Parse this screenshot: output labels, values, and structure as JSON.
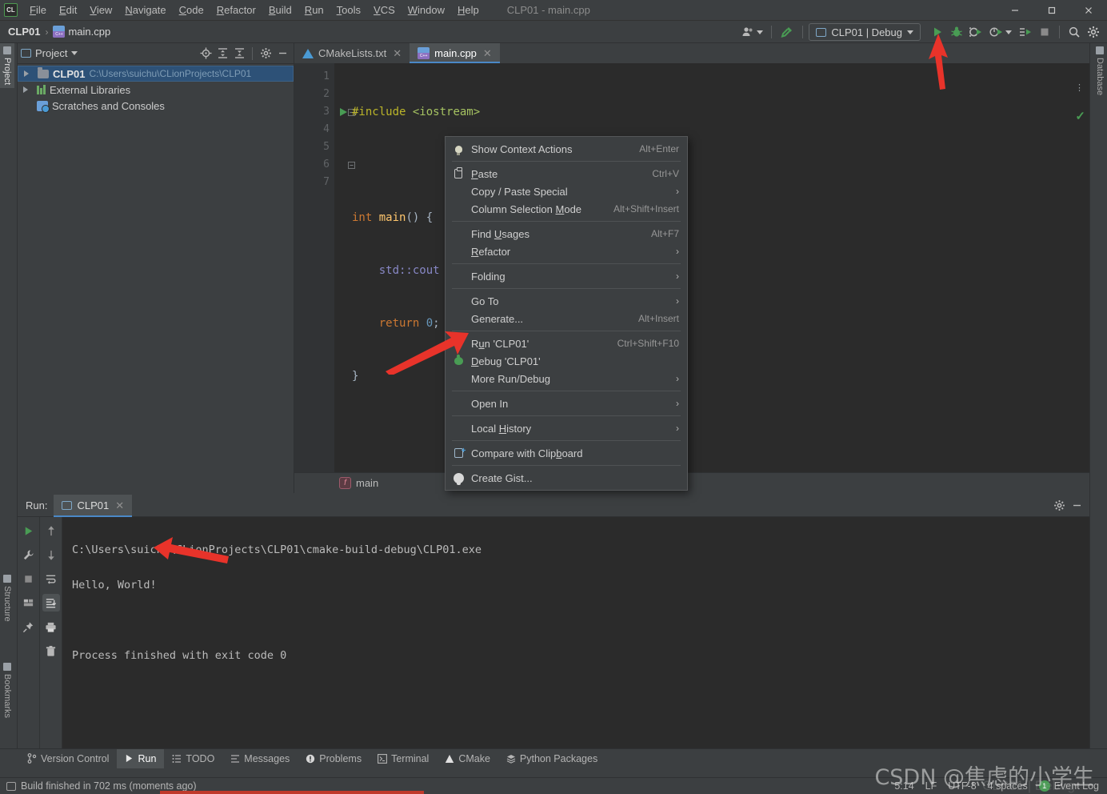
{
  "window": {
    "title": "CLP01 - main.cpp",
    "app_icon": "CL",
    "controls": {
      "minimize": "minimize-icon",
      "maximize": "maximize-icon",
      "close": "close-icon"
    }
  },
  "menubar": {
    "items": [
      {
        "label": "File",
        "mnemonic": "F"
      },
      {
        "label": "Edit",
        "mnemonic": "E"
      },
      {
        "label": "View",
        "mnemonic": "V"
      },
      {
        "label": "Navigate",
        "mnemonic": "N"
      },
      {
        "label": "Code",
        "mnemonic": "C"
      },
      {
        "label": "Refactor",
        "mnemonic": "R"
      },
      {
        "label": "Build",
        "mnemonic": "B"
      },
      {
        "label": "Run",
        "mnemonic": "R"
      },
      {
        "label": "Tools",
        "mnemonic": "T"
      },
      {
        "label": "VCS",
        "mnemonic": "V"
      },
      {
        "label": "Window",
        "mnemonic": "W"
      },
      {
        "label": "Help",
        "mnemonic": "H"
      }
    ]
  },
  "navbar": {
    "project": "CLP01",
    "separator": "›",
    "file": "main.cpp"
  },
  "toolbar": {
    "run_config": "CLP01 | Debug",
    "buttons": [
      "user-account-icon",
      "build-hammer-icon",
      "run-icon",
      "debug-icon",
      "run-with-coverage-icon",
      "profile-icon",
      "attach-process-icon",
      "stop-icon",
      "search-everywhere-icon",
      "settings-gear-icon"
    ]
  },
  "rails": {
    "left": [
      {
        "label": "Project",
        "selected": true
      },
      {
        "label": "Structure",
        "selected": false
      },
      {
        "label": "Bookmarks",
        "selected": false
      }
    ],
    "right": [
      {
        "label": "Database",
        "selected": false
      }
    ]
  },
  "project_panel": {
    "title": "Project",
    "toolbar": [
      "locate-target-icon",
      "expand-all-icon",
      "collapse-all-icon",
      "settings-gear-icon",
      "hide-icon"
    ],
    "tree": [
      {
        "name": "CLP01",
        "path": "C:\\Users\\suichu\\CLionProjects\\CLP01",
        "icon": "folder-icon",
        "selected": true,
        "expandable": true
      },
      {
        "name": "External Libraries",
        "path": "",
        "icon": "library-icon",
        "selected": false,
        "expandable": true
      },
      {
        "name": "Scratches and Consoles",
        "path": "",
        "icon": "scratches-icon",
        "selected": false,
        "expandable": false
      }
    ]
  },
  "editor": {
    "tabs": [
      {
        "label": "CMakeLists.txt",
        "icon": "cmake-icon",
        "active": false
      },
      {
        "label": "main.cpp",
        "icon": "cpp-file-icon",
        "active": true
      }
    ],
    "line_numbers": [
      "1",
      "2",
      "3",
      "4",
      "5",
      "6",
      "7"
    ],
    "code_lines": [
      "#include <iostream>",
      "",
      "int main() {",
      "    std::cout << \"Hello, World!\" << std::endl;",
      "    return 0;",
      "}",
      ""
    ],
    "breadcrumb": "main",
    "inspection_status": "no-errors-check-icon"
  },
  "context_menu": {
    "items": [
      {
        "label": "Show Context Actions",
        "mnemonic": "",
        "shortcut": "Alt+Enter",
        "icon": "lightbulb-icon",
        "submenu": false
      },
      {
        "separator": true
      },
      {
        "label": "Paste",
        "mnemonic": "P",
        "shortcut": "Ctrl+V",
        "icon": "clipboard-icon",
        "submenu": false
      },
      {
        "label": "Copy / Paste Special",
        "mnemonic": "",
        "shortcut": "",
        "icon": "",
        "submenu": true
      },
      {
        "label": "Column Selection Mode",
        "mnemonic": "M",
        "shortcut": "Alt+Shift+Insert",
        "icon": "",
        "submenu": false
      },
      {
        "separator": true
      },
      {
        "label": "Find Usages",
        "mnemonic": "U",
        "shortcut": "Alt+F7",
        "icon": "",
        "submenu": false
      },
      {
        "label": "Refactor",
        "mnemonic": "R",
        "shortcut": "",
        "icon": "",
        "submenu": true
      },
      {
        "separator": true
      },
      {
        "label": "Folding",
        "mnemonic": "",
        "shortcut": "",
        "icon": "",
        "submenu": true
      },
      {
        "separator": true
      },
      {
        "label": "Go To",
        "mnemonic": "",
        "shortcut": "",
        "icon": "",
        "submenu": true
      },
      {
        "label": "Generate...",
        "mnemonic": "",
        "shortcut": "Alt+Insert",
        "icon": "",
        "submenu": false
      },
      {
        "separator": true
      },
      {
        "label": "Run 'CLP01'",
        "mnemonic": "u",
        "shortcut": "Ctrl+Shift+F10",
        "icon": "run-icon",
        "submenu": false
      },
      {
        "label": "Debug 'CLP01'",
        "mnemonic": "D",
        "shortcut": "",
        "icon": "debug-icon",
        "submenu": false
      },
      {
        "label": "More Run/Debug",
        "mnemonic": "",
        "shortcut": "",
        "icon": "",
        "submenu": true
      },
      {
        "separator": true
      },
      {
        "label": "Open In",
        "mnemonic": "",
        "shortcut": "",
        "icon": "",
        "submenu": true
      },
      {
        "separator": true
      },
      {
        "label": "Local History",
        "mnemonic": "H",
        "shortcut": "",
        "icon": "",
        "submenu": true
      },
      {
        "separator": true
      },
      {
        "label": "Compare with Clipboard",
        "mnemonic": "b",
        "shortcut": "",
        "icon": "compare-icon",
        "submenu": false
      },
      {
        "separator": true
      },
      {
        "label": "Create Gist...",
        "mnemonic": "",
        "shortcut": "",
        "icon": "github-icon",
        "submenu": false
      }
    ]
  },
  "run_window": {
    "label": "Run:",
    "tab": "CLP01",
    "tab_icon": "run-config-icon",
    "header_buttons": [
      "settings-gear-icon",
      "hide-icon"
    ],
    "side_buttons": [
      "rerun-icon",
      "wrench-icon",
      "stop-icon",
      "layout-icon",
      "pin-icon"
    ],
    "side_buttons2": [
      "up-arrow-icon",
      "down-arrow-icon",
      "soft-wrap-icon",
      "scroll-to-end-icon",
      "print-icon",
      "trash-icon"
    ],
    "console_lines": [
      "C:\\Users\\suichu\\CLionProjects\\CLP01\\cmake-build-debug\\CLP01.exe",
      "Hello, World!",
      "",
      "Process finished with exit code 0"
    ]
  },
  "bottom_tabs": [
    {
      "label": "Version Control",
      "icon": "branch-icon",
      "active": false
    },
    {
      "label": "Run",
      "icon": "run-icon",
      "active": true
    },
    {
      "label": "TODO",
      "icon": "todo-icon",
      "active": false
    },
    {
      "label": "Messages",
      "icon": "messages-icon",
      "active": false
    },
    {
      "label": "Problems",
      "icon": "problems-icon",
      "active": false
    },
    {
      "label": "Terminal",
      "icon": "terminal-icon",
      "active": false
    },
    {
      "label": "CMake",
      "icon": "cmake-icon",
      "active": false
    },
    {
      "label": "Python Packages",
      "icon": "packages-icon",
      "active": false
    }
  ],
  "statusbar": {
    "message": "Build finished in 702 ms (moments ago)",
    "caret_position": "5:14",
    "line_separator": "LF",
    "encoding": "UTF-8",
    "indent": "4 spaces",
    "event_log": "Event Log",
    "event_log_count": "1"
  },
  "watermark": {
    "text": "CSDN @焦虑的小学生",
    "ghost": "CLP01 | Debug"
  },
  "colors": {
    "accent_blue": "#4a88c7",
    "run_green": "#499c54",
    "selection_blue": "#2d5177",
    "annotation_red": "#e8332a",
    "editor_bg": "#2b2b2b",
    "panel_bg": "#3c3f41"
  }
}
